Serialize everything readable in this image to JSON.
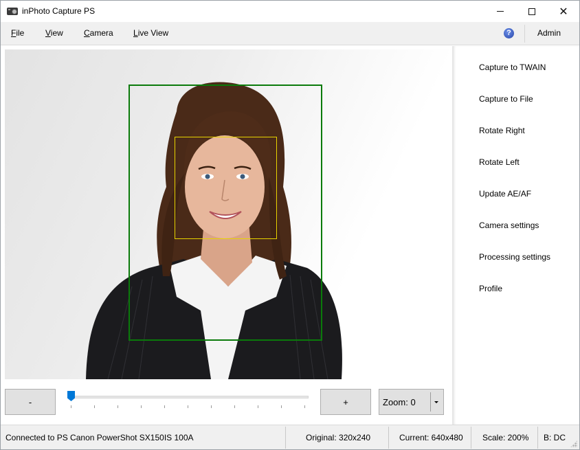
{
  "window": {
    "title": "inPhoto Capture PS",
    "controls": {
      "minimize": "minimize",
      "maximize": "maximize",
      "close": "close"
    }
  },
  "menubar": {
    "items": [
      {
        "label": "File",
        "mnemonic": "F"
      },
      {
        "label": "View",
        "mnemonic": "V"
      },
      {
        "label": "Camera",
        "mnemonic": "C"
      },
      {
        "label": "Live View",
        "mnemonic": "L"
      }
    ],
    "help_icon": "?",
    "admin_label": "Admin"
  },
  "sidebar": {
    "items": [
      {
        "label": "Capture to TWAIN"
      },
      {
        "label": "Capture to File"
      },
      {
        "label": "Rotate Right"
      },
      {
        "label": "Rotate Left"
      },
      {
        "label": "Update AE/AF"
      },
      {
        "label": "Camera settings"
      },
      {
        "label": "Processing settings"
      },
      {
        "label": "Profile"
      }
    ]
  },
  "preview": {
    "description": "Live view portrait of a woman with brown wavy hair in a dark pinstripe suit and white shirt",
    "frame_colors": {
      "outer": "#0a7a0a",
      "face": "#e8d400"
    }
  },
  "controls": {
    "minus_label": "-",
    "plus_label": "+",
    "zoom_slider": {
      "value": 0,
      "min": 0,
      "max": 10
    },
    "zoom_combo_label": "Zoom: 0"
  },
  "statusbar": {
    "connection": "Connected to PS Canon PowerShot SX150IS 100A",
    "original": "Original: 320x240",
    "current": "Current: 640x480",
    "scale": "Scale: 200%",
    "mode": "B: DC"
  },
  "colors": {
    "accent": "#0078d7",
    "menubar_bg": "#f0f0f0",
    "button_bg": "#e1e1e1"
  }
}
